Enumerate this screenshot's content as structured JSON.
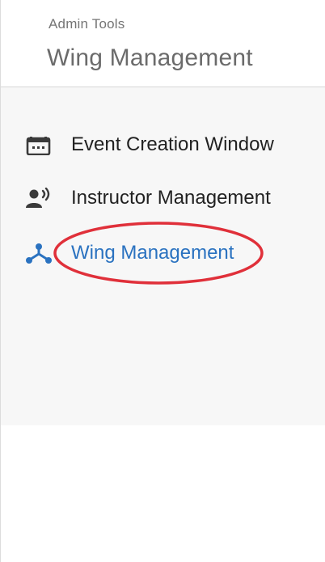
{
  "header": {
    "subtitle": "Admin Tools",
    "title": "Wing Management"
  },
  "nav": {
    "items": [
      {
        "label": "Event Creation Window",
        "icon": "calendar-icon",
        "active": false
      },
      {
        "label": "Instructor Management",
        "icon": "person-speaking-icon",
        "active": false
      },
      {
        "label": "Wing Management",
        "icon": "hierarchy-icon",
        "active": true
      }
    ]
  },
  "colors": {
    "active": "#2a72c0",
    "text": "#222222",
    "muted": "#757575",
    "panel_background": "#f7f7f7",
    "annotation": "#e0303a"
  }
}
